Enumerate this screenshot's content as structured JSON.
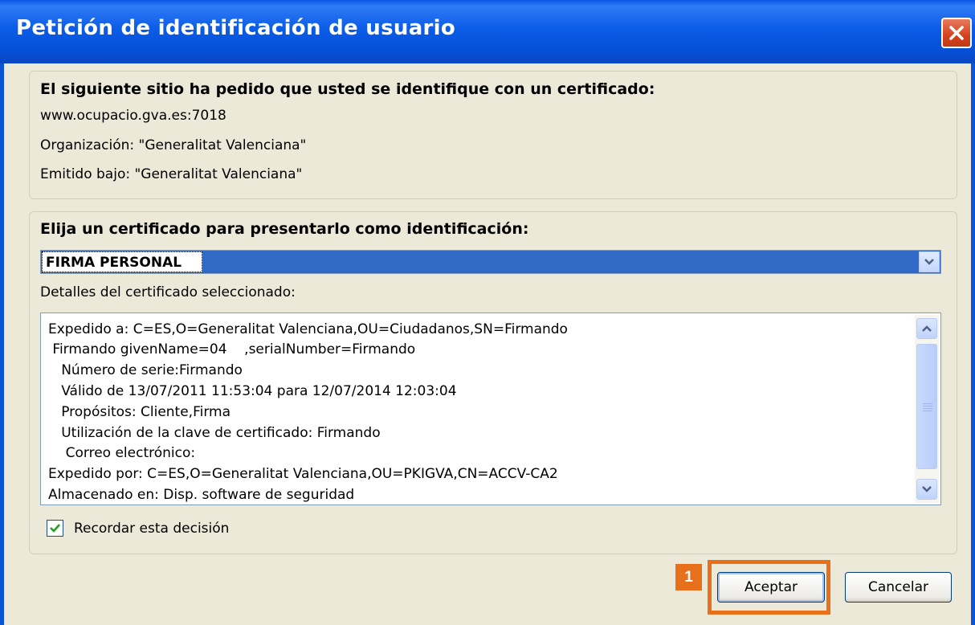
{
  "window": {
    "title": "Petición de identificación de usuario"
  },
  "site_info": {
    "heading": "El siguiente sitio ha pedido que usted se identifique con un certificado:",
    "host": "www.ocupacio.gva.es:7018",
    "organization": "Organización: \"Generalitat Valenciana\"",
    "issued_under": "Emitido bajo: \"Generalitat Valenciana\""
  },
  "certificate": {
    "heading": "Elija un certificado para presentarlo como identificación:",
    "selected": "FIRMA PERSONAL",
    "details_label": "Detalles del certificado seleccionado:",
    "details_lines": [
      "Expedido a: C=ES,O=Generalitat Valenciana,OU=Ciudadanos,SN=Firmando",
      " Firmando givenName=04    ,serialNumber=Firmando",
      "   Número de serie:Firmando",
      "   Válido de 13/07/2011 11:53:04 para 12/07/2014 12:03:04",
      "   Propósitos: Cliente,Firma",
      "   Utilización de la clave de certificado: Firmando",
      "    Correo electrónico:",
      "Expedido por: C=ES,O=Generalitat Valenciana,OU=PKIGVA,CN=ACCV-CA2",
      "Almacenado en: Disp. software de seguridad"
    ],
    "remember_label": "Recordar esta decisión",
    "remember_checked": true
  },
  "buttons": {
    "accept": "Aceptar",
    "cancel": "Cancelar"
  },
  "annotation": {
    "badge": "1",
    "color": "#E8701A"
  },
  "colors": {
    "titlebar": "#0A58E6",
    "selection": "#3169C6",
    "face": "#ECE9D8"
  }
}
